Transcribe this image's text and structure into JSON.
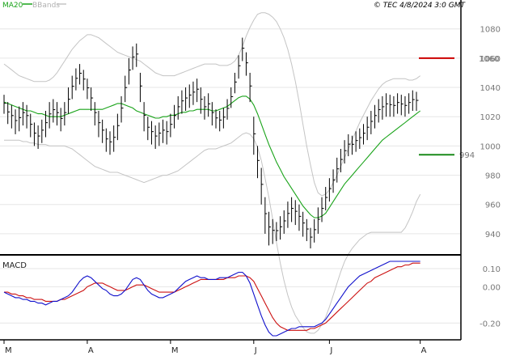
{
  "header": {
    "ma_label": "MA20",
    "bb_label": "BBands",
    "timestamp": "© TEC 4/8/2024 3:0 GMT"
  },
  "colors": {
    "price": "#000000",
    "ma": "#19a319",
    "bands": "#c4c4c4",
    "resistance": "#cc0000",
    "support": "#1a8a1a",
    "macd_line": "#1010cc",
    "signal_line": "#cc1010",
    "grid": "#e6e6e6"
  },
  "chart_data": [
    {
      "type": "ohlc",
      "title": "",
      "legend": [
        "MA20",
        "BBands"
      ],
      "legend_position": "top-left",
      "grid": true,
      "ylim": [
        930,
        1092
      ],
      "y_ticks": [
        940,
        960,
        980,
        1000,
        1020,
        1040,
        1060,
        1080
      ],
      "x_ticks": [
        {
          "label": "M",
          "index": 0
        },
        {
          "label": "A",
          "index": 22
        },
        {
          "label": "M",
          "index": 44
        },
        {
          "label": "J",
          "index": 66
        },
        {
          "label": "J",
          "index": 86
        },
        {
          "label": "A",
          "index": 110
        }
      ],
      "levels": [
        {
          "name": "resistance",
          "value": 1060,
          "label": "1060"
        },
        {
          "name": "support",
          "value": 994,
          "label": "994"
        }
      ],
      "bars": [
        {
          "h": 1035,
          "l": 1022
        },
        {
          "h": 1030,
          "l": 1015
        },
        {
          "h": 1028,
          "l": 1012
        },
        {
          "h": 1025,
          "l": 1008
        },
        {
          "h": 1027,
          "l": 1010
        },
        {
          "h": 1030,
          "l": 1014
        },
        {
          "h": 1028,
          "l": 1012
        },
        {
          "h": 1022,
          "l": 1006
        },
        {
          "h": 1016,
          "l": 1000
        },
        {
          "h": 1014,
          "l": 998
        },
        {
          "h": 1018,
          "l": 1002
        },
        {
          "h": 1024,
          "l": 1006
        },
        {
          "h": 1030,
          "l": 1012
        },
        {
          "h": 1032,
          "l": 1016
        },
        {
          "h": 1030,
          "l": 1014
        },
        {
          "h": 1026,
          "l": 1010
        },
        {
          "h": 1030,
          "l": 1014
        },
        {
          "h": 1040,
          "l": 1022
        },
        {
          "h": 1048,
          "l": 1032
        },
        {
          "h": 1053,
          "l": 1038
        },
        {
          "h": 1056,
          "l": 1042
        },
        {
          "h": 1052,
          "l": 1038
        },
        {
          "h": 1046,
          "l": 1032
        },
        {
          "h": 1040,
          "l": 1024
        },
        {
          "h": 1030,
          "l": 1014
        },
        {
          "h": 1024,
          "l": 1006
        },
        {
          "h": 1018,
          "l": 1002
        },
        {
          "h": 1012,
          "l": 996
        },
        {
          "h": 1010,
          "l": 994
        },
        {
          "h": 1014,
          "l": 996
        },
        {
          "h": 1022,
          "l": 1004
        },
        {
          "h": 1034,
          "l": 1016
        },
        {
          "h": 1048,
          "l": 1030
        },
        {
          "h": 1060,
          "l": 1042
        },
        {
          "h": 1068,
          "l": 1052
        },
        {
          "h": 1070,
          "l": 1054
        },
        {
          "h": 1050,
          "l": 1030
        },
        {
          "h": 1030,
          "l": 1010
        },
        {
          "h": 1020,
          "l": 1004
        },
        {
          "h": 1017,
          "l": 1001
        },
        {
          "h": 1014,
          "l": 998
        },
        {
          "h": 1016,
          "l": 1000
        },
        {
          "h": 1018,
          "l": 1002
        },
        {
          "h": 1017,
          "l": 1001
        },
        {
          "h": 1022,
          "l": 1006
        },
        {
          "h": 1028,
          "l": 1012
        },
        {
          "h": 1034,
          "l": 1018
        },
        {
          "h": 1038,
          "l": 1022
        },
        {
          "h": 1040,
          "l": 1024
        },
        {
          "h": 1042,
          "l": 1026
        },
        {
          "h": 1044,
          "l": 1028
        },
        {
          "h": 1046,
          "l": 1030
        },
        {
          "h": 1040,
          "l": 1022
        },
        {
          "h": 1034,
          "l": 1018
        },
        {
          "h": 1036,
          "l": 1020
        },
        {
          "h": 1030,
          "l": 1014
        },
        {
          "h": 1025,
          "l": 1012
        },
        {
          "h": 1024,
          "l": 1010
        },
        {
          "h": 1026,
          "l": 1012
        },
        {
          "h": 1032,
          "l": 1018
        },
        {
          "h": 1040,
          "l": 1026
        },
        {
          "h": 1050,
          "l": 1036
        },
        {
          "h": 1062,
          "l": 1046
        },
        {
          "h": 1074,
          "l": 1058
        },
        {
          "h": 1064,
          "l": 1048
        },
        {
          "h": 1050,
          "l": 1030
        },
        {
          "h": 1020,
          "l": 994
        },
        {
          "h": 1000,
          "l": 978
        },
        {
          "h": 985,
          "l": 960
        },
        {
          "h": 965,
          "l": 940
        },
        {
          "h": 955,
          "l": 932
        },
        {
          "h": 950,
          "l": 933
        },
        {
          "h": 948,
          "l": 935
        },
        {
          "h": 952,
          "l": 936
        },
        {
          "h": 956,
          "l": 940
        },
        {
          "h": 962,
          "l": 944
        },
        {
          "h": 965,
          "l": 948
        },
        {
          "h": 963,
          "l": 946
        },
        {
          "h": 960,
          "l": 942
        },
        {
          "h": 955,
          "l": 938
        },
        {
          "h": 950,
          "l": 935
        },
        {
          "h": 944,
          "l": 930
        },
        {
          "h": 950,
          "l": 934
        },
        {
          "h": 958,
          "l": 940
        },
        {
          "h": 965,
          "l": 948
        },
        {
          "h": 972,
          "l": 956
        },
        {
          "h": 978,
          "l": 962
        },
        {
          "h": 984,
          "l": 968
        },
        {
          "h": 992,
          "l": 975
        },
        {
          "h": 998,
          "l": 982
        },
        {
          "h": 1004,
          "l": 988
        },
        {
          "h": 1008,
          "l": 993
        },
        {
          "h": 1007,
          "l": 994
        },
        {
          "h": 1010,
          "l": 996
        },
        {
          "h": 1012,
          "l": 998
        },
        {
          "h": 1015,
          "l": 1001
        },
        {
          "h": 1020,
          "l": 1004
        },
        {
          "h": 1024,
          "l": 1008
        },
        {
          "h": 1028,
          "l": 1012
        },
        {
          "h": 1032,
          "l": 1016
        },
        {
          "h": 1034,
          "l": 1018
        },
        {
          "h": 1036,
          "l": 1020
        },
        {
          "h": 1035,
          "l": 1020
        },
        {
          "h": 1034,
          "l": 1020
        },
        {
          "h": 1036,
          "l": 1022
        },
        {
          "h": 1035,
          "l": 1021
        },
        {
          "h": 1034,
          "l": 1020
        },
        {
          "h": 1036,
          "l": 1022
        },
        {
          "h": 1038,
          "l": 1024
        },
        {
          "h": 1037,
          "l": 1024
        }
      ],
      "series": [
        {
          "name": "MA20",
          "values": [
            1030,
            1029,
            1028,
            1027,
            1026,
            1025,
            1024,
            1024,
            1023,
            1022,
            1022,
            1021,
            1020,
            1020,
            1020,
            1020,
            1021,
            1022,
            1023,
            1024,
            1025,
            1025,
            1025,
            1025,
            1025,
            1025,
            1025,
            1026,
            1027,
            1028,
            1029,
            1029,
            1028,
            1027,
            1026,
            1024,
            1023,
            1022,
            1021,
            1020,
            1019,
            1019,
            1020,
            1020,
            1021,
            1021,
            1022,
            1023,
            1023,
            1024,
            1024,
            1025,
            1025,
            1025,
            1025,
            1024,
            1024,
            1025,
            1026,
            1027,
            1029,
            1031,
            1033,
            1034,
            1034,
            1032,
            1028,
            1022,
            1015,
            1008,
            1001,
            995,
            989,
            984,
            979,
            975,
            971,
            967,
            963,
            959,
            956,
            953,
            951,
            951,
            952,
            954,
            958,
            962,
            966,
            970,
            974,
            977,
            980,
            983,
            986,
            989,
            992,
            995,
            998,
            1001,
            1004,
            1006,
            1008,
            1010,
            1012,
            1014,
            1016,
            1018,
            1020,
            1022,
            1024
          ]
        },
        {
          "name": "BBands upper",
          "values": [
            1056,
            1054,
            1052,
            1050,
            1048,
            1047,
            1046,
            1045,
            1044,
            1044,
            1044,
            1044,
            1045,
            1047,
            1050,
            1054,
            1058,
            1062,
            1066,
            1069,
            1072,
            1074,
            1076,
            1076,
            1075,
            1074,
            1072,
            1070,
            1068,
            1066,
            1064,
            1063,
            1062,
            1061,
            1060,
            1059,
            1058,
            1056,
            1054,
            1052,
            1050,
            1049,
            1048,
            1048,
            1048,
            1048,
            1049,
            1050,
            1051,
            1052,
            1053,
            1054,
            1055,
            1056,
            1056,
            1056,
            1056,
            1055,
            1055,
            1055,
            1056,
            1058,
            1062,
            1068,
            1075,
            1081,
            1086,
            1090,
            1091,
            1091,
            1090,
            1088,
            1085,
            1080,
            1074,
            1066,
            1056,
            1044,
            1030,
            1015,
            1000,
            987,
            975,
            968,
            966,
            967,
            970,
            975,
            980,
            986,
            992,
            998,
            1004,
            1010,
            1016,
            1021,
            1026,
            1031,
            1035,
            1039,
            1042,
            1044,
            1045,
            1046,
            1046,
            1046,
            1046,
            1045,
            1045,
            1046,
            1048
          ]
        },
        {
          "name": "BBands lower",
          "values": [
            1004,
            1004,
            1004,
            1004,
            1004,
            1003,
            1003,
            1002,
            1002,
            1001,
            1001,
            1001,
            1000,
            1000,
            1000,
            1000,
            1000,
            999,
            998,
            996,
            994,
            992,
            990,
            988,
            986,
            985,
            984,
            983,
            982,
            982,
            982,
            981,
            980,
            979,
            978,
            977,
            976,
            975,
            976,
            977,
            978,
            979,
            980,
            980,
            981,
            982,
            983,
            985,
            987,
            989,
            991,
            993,
            995,
            997,
            998,
            998,
            998,
            999,
            1000,
            1001,
            1002,
            1004,
            1006,
            1008,
            1009,
            1008,
            1005,
            999,
            990,
            978,
            965,
            950,
            934,
            920,
            908,
            898,
            890,
            884,
            880,
            876,
            873,
            872,
            872,
            874,
            878,
            883,
            890,
            898,
            906,
            914,
            921,
            926,
            930,
            933,
            936,
            938,
            940,
            941,
            941,
            941,
            941,
            941,
            941,
            941,
            941,
            941,
            944,
            949,
            955,
            962,
            967
          ]
        }
      ]
    },
    {
      "type": "line",
      "title": "MACD",
      "ylim": [
        -27,
        14
      ],
      "y_ticks": [
        -20,
        0,
        10
      ],
      "y_tick_labels": [
        "-0.20",
        "0.00",
        "0.10"
      ],
      "series": [
        {
          "name": "MACD",
          "values": [
            -3,
            -4,
            -5,
            -6,
            -6,
            -7,
            -7,
            -8,
            -8,
            -9,
            -9,
            -10,
            -9,
            -8,
            -8,
            -7,
            -6,
            -5,
            -3,
            0,
            3,
            5,
            6,
            5,
            3,
            1,
            -1,
            -2,
            -4,
            -5,
            -5,
            -4,
            -2,
            1,
            4,
            5,
            4,
            1,
            -2,
            -4,
            -5,
            -6,
            -6,
            -5,
            -4,
            -3,
            -1,
            1,
            3,
            4,
            5,
            6,
            5,
            5,
            4,
            4,
            4,
            5,
            5,
            5,
            6,
            7,
            8,
            8,
            6,
            2,
            -4,
            -10,
            -16,
            -21,
            -25,
            -27,
            -27,
            -26,
            -25,
            -24,
            -23,
            -23,
            -22,
            -22,
            -22,
            -22,
            -22,
            -21,
            -20,
            -18,
            -15,
            -12,
            -9,
            -6,
            -3,
            0,
            2,
            4,
            6,
            7,
            8,
            9,
            10,
            11,
            12,
            13,
            14,
            14,
            14,
            14,
            14,
            14,
            14,
            14,
            14
          ]
        },
        {
          "name": "Signal",
          "values": [
            -3,
            -3,
            -4,
            -4,
            -5,
            -5,
            -6,
            -6,
            -7,
            -7,
            -7,
            -8,
            -8,
            -8,
            -8,
            -7,
            -7,
            -6,
            -5,
            -4,
            -3,
            -2,
            0,
            1,
            2,
            2,
            2,
            1,
            0,
            -1,
            -2,
            -2,
            -2,
            -1,
            0,
            1,
            1,
            1,
            0,
            -1,
            -2,
            -3,
            -3,
            -3,
            -3,
            -3,
            -2,
            -1,
            0,
            1,
            2,
            3,
            4,
            4,
            4,
            4,
            4,
            4,
            4,
            5,
            5,
            5,
            6,
            6,
            6,
            5,
            3,
            -1,
            -5,
            -9,
            -13,
            -17,
            -20,
            -22,
            -23,
            -24,
            -24,
            -24,
            -24,
            -24,
            -24,
            -23,
            -23,
            -22,
            -21,
            -20,
            -18,
            -16,
            -14,
            -12,
            -10,
            -8,
            -6,
            -4,
            -2,
            0,
            2,
            3,
            5,
            6,
            7,
            8,
            9,
            10,
            11,
            11,
            12,
            12,
            13,
            13,
            13
          ]
        }
      ]
    }
  ]
}
